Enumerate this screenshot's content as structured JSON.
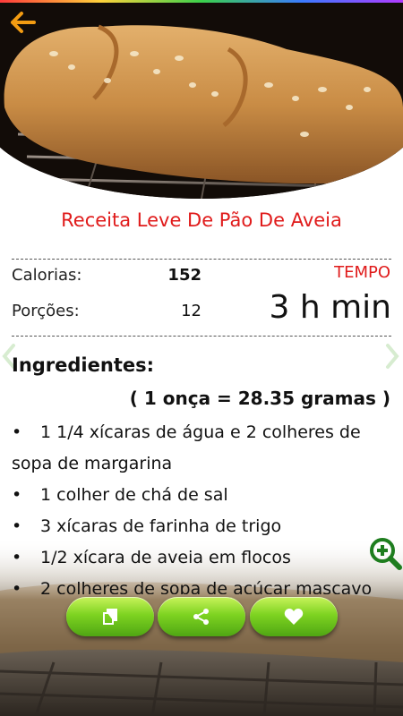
{
  "header": {
    "back_icon": "arrow-left-icon",
    "hero_image": "oat-bread-loaf-photo"
  },
  "recipe": {
    "title": "Receita Leve De Pão De Aveia",
    "calories_label": "Calorias:",
    "calories_value": "152",
    "servings_label": "Porções:",
    "servings_value": "12",
    "time_label": "TEMPO",
    "time_value": "3 h min"
  },
  "ingredients": {
    "heading": "Ingredientes:",
    "conversion": "( 1 onça = 28.35 gramas )",
    "items": [
      "1 1/4 xícaras de água e 2 colheres de sopa de margarina",
      "1 colher de chá de sal",
      "3 xícaras de farinha de trigo",
      "1/2 xícara de aveia em flocos",
      "2 colheres de sopa de açúcar mascavo"
    ]
  },
  "actions": {
    "copy_icon": "copy-icon",
    "share_icon": "share-icon",
    "favorite_icon": "heart-icon",
    "zoom_icon": "zoom-in-icon"
  },
  "colors": {
    "accent_red": "#e01b1b",
    "button_green": "#7ed321",
    "arrow_orange": "#f39c12"
  }
}
